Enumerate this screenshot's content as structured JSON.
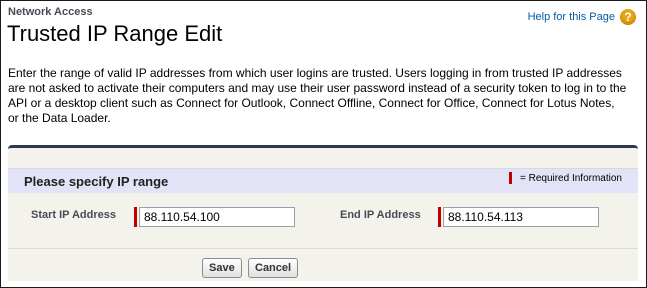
{
  "header": {
    "breadcrumb": "Network Access",
    "title": "Trusted IP Range Edit",
    "help_link": "Help for this Page",
    "help_icon": "help-icon"
  },
  "description": "Enter the range of valid IP addresses from which user logins are trusted. Users logging in from trusted IP addresses are not asked to activate their computers and may use their user password instead of a security token to log in to the API or a desktop client such as Connect for Outlook, Connect Offline, Connect for Office, Connect for Lotus Notes, or the Data Loader.",
  "form": {
    "section_title": "Please specify IP range",
    "required_legend": "= Required Information",
    "start_ip": {
      "label": "Start IP Address",
      "value": "88.110.54.100"
    },
    "end_ip": {
      "label": "End IP Address",
      "value": "88.110.54.113"
    },
    "save_label": "Save",
    "cancel_label": "Cancel"
  },
  "colors": {
    "required": "#c00000",
    "link": "#015ba7",
    "panel_border": "#2e3a52",
    "section_header": "#e3e3f7",
    "help_icon": "#e8a512"
  }
}
